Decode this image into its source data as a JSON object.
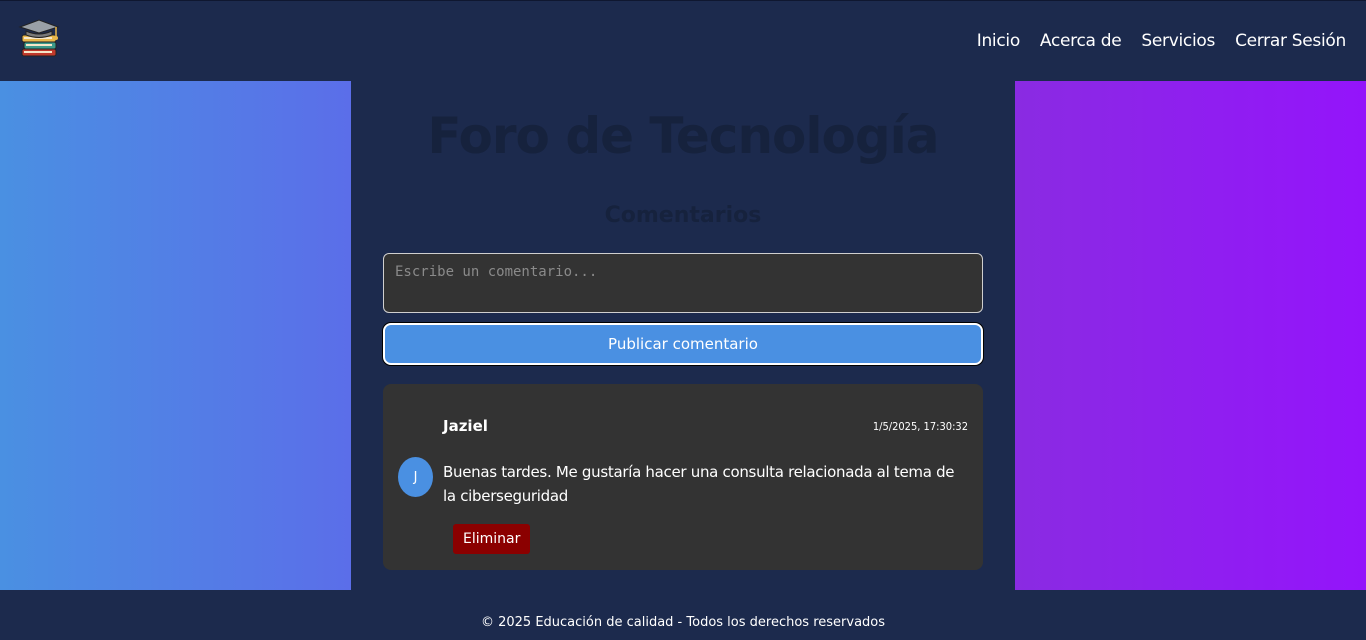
{
  "header": {
    "logo_icon": "graduation-cap-books-icon",
    "nav": [
      "Inicio",
      "Acerca de",
      "Servicios",
      "Cerrar Sesión"
    ]
  },
  "main": {
    "title": "Foro de Tecnología",
    "subtitle": "Comentarios",
    "comment_input": {
      "placeholder": "Escribe un comentario...",
      "value": ""
    },
    "publish_label": "Publicar comentario",
    "comments": [
      {
        "avatar_initial": "J",
        "author": "Jaziel",
        "timestamp": "1/5/2025, 17:30:32",
        "text": "Buenas tardes. Me gustaría hacer una consulta relacionada al tema de la ciberseguridad",
        "delete_label": "Eliminar"
      }
    ]
  },
  "footer": {
    "text": "© 2025 Educación de calidad - Todos los derechos reservados"
  },
  "colors": {
    "background": "#1c2a4d",
    "accent_blue": "#4a90e2",
    "accent_purple": "#8a2be2",
    "card": "#333333",
    "danger": "#8b0000"
  }
}
